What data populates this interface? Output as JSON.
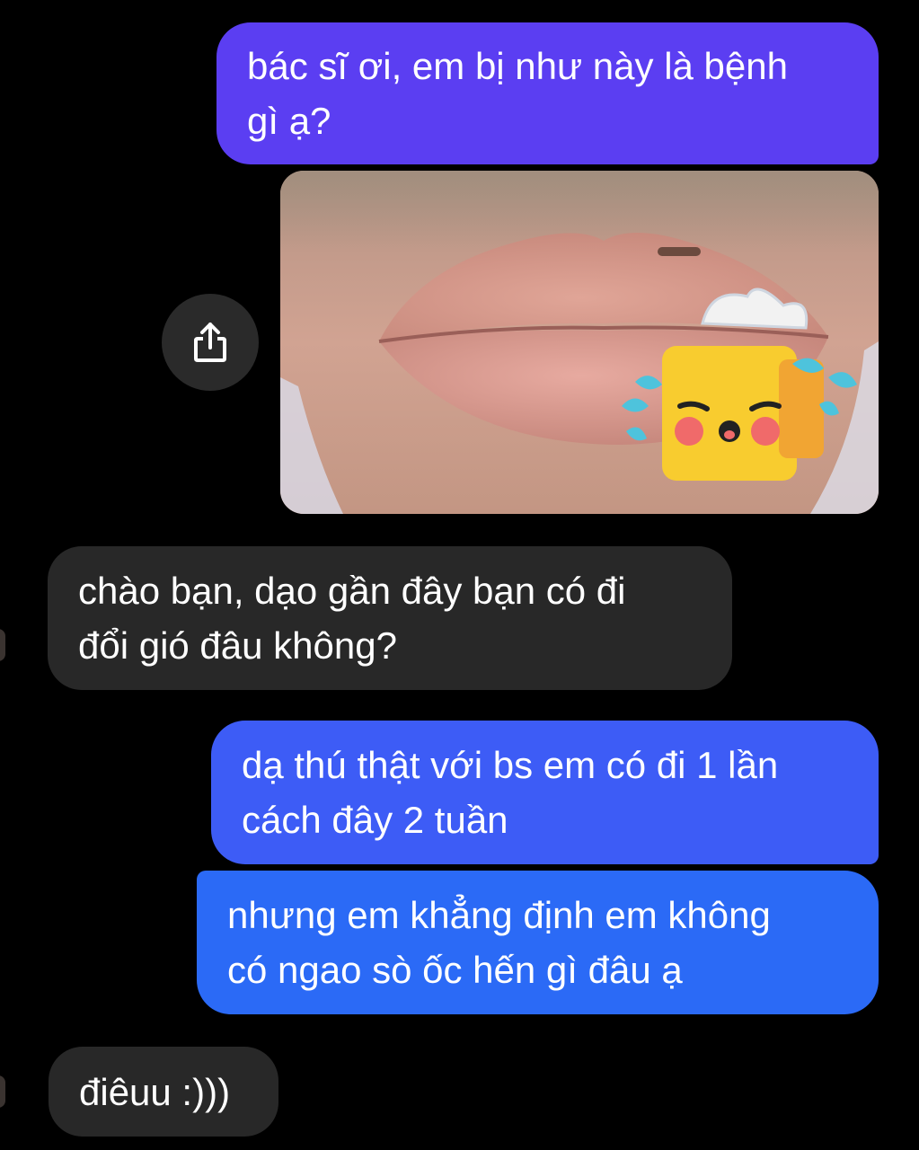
{
  "conversation": {
    "messages": [
      {
        "sender": "user",
        "lines": [
          "bác sĩ ơi, em bị như này là bệnh",
          "gì ạ?"
        ],
        "color": "#5b3ef2"
      },
      {
        "sender": "user",
        "type": "photo",
        "image_description_icon": "crying-tissue-box-sticker",
        "share_icon": "share-icon"
      },
      {
        "sender": "other",
        "lines": [
          "chào bạn, dạo gần đây bạn có đi",
          "đổi gió đâu không?"
        ],
        "color": "#282828"
      },
      {
        "sender": "user",
        "lines": [
          "dạ thú thật với bs em có đi 1 lần",
          "cách đây 2 tuần"
        ],
        "color": "#3d5cf6"
      },
      {
        "sender": "user",
        "lines": [
          "nhưng em khẳng định em không",
          "có ngao sò ốc hến gì đâu ạ"
        ],
        "color": "#2b6af6"
      },
      {
        "sender": "other",
        "lines": [
          "điêuu :)))"
        ],
        "color": "#282828"
      }
    ]
  }
}
